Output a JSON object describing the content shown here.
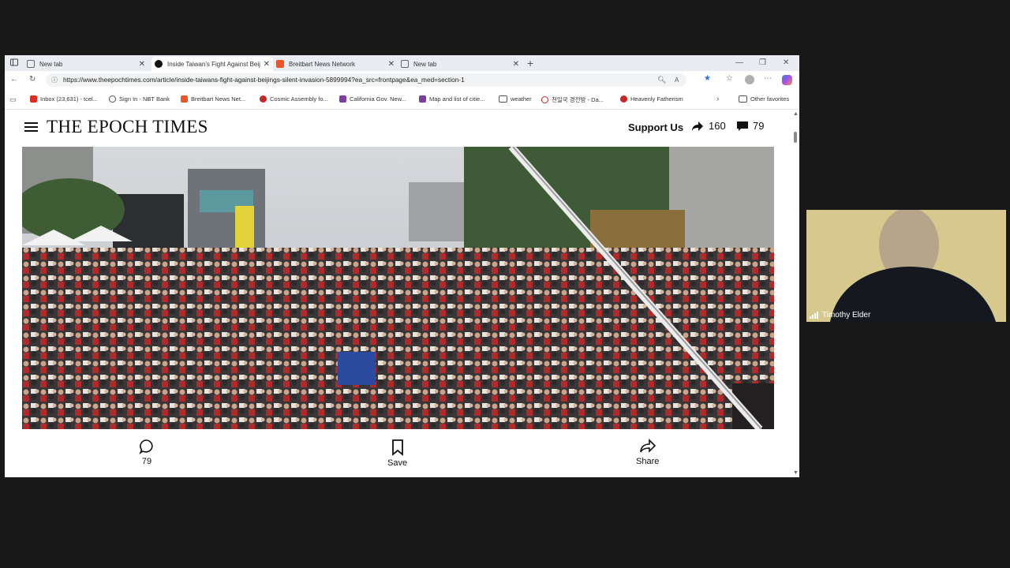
{
  "browser": {
    "tabs": [
      {
        "label": "New tab",
        "favicon": "page-icon",
        "active": false
      },
      {
        "label": "Inside Taiwan's Fight Against Beij",
        "favicon": "epoch-times-icon",
        "active": true
      },
      {
        "label": "Breitbart News Network",
        "favicon": "breitbart-icon",
        "active": false
      },
      {
        "label": "New tab",
        "favicon": "page-icon",
        "active": false
      }
    ],
    "url": "https://www.theepochtimes.com/article/inside-taiwans-fight-against-beijings-silent-invasion-5899994?ea_src=frontpage&ea_med=section-1",
    "bookmarks": [
      {
        "label": "Inbox (23,631) - tcel...",
        "icon": "gmail-icon",
        "color": "#d93025"
      },
      {
        "label": "Sign In - NBT Bank",
        "icon": "globe-icon",
        "color": "#555555"
      },
      {
        "label": "Breitbart News Net...",
        "icon": "breitbart-icon",
        "color": "#e8562a"
      },
      {
        "label": "Cosmic Assembly fo...",
        "icon": "cosmic-icon",
        "color": "#c62828"
      },
      {
        "label": "California Gov. New...",
        "icon": "news-icon",
        "color": "#7b3fa0"
      },
      {
        "label": "Map and list of citie...",
        "icon": "map-icon",
        "color": "#7b3fa0"
      },
      {
        "label": "weather",
        "icon": "folder-icon",
        "color": "#555555"
      },
      {
        "label": "천일국 경전방 - Da...",
        "icon": "site-icon",
        "color": "#c62828"
      },
      {
        "label": "Heavenly Fatherism",
        "icon": "heart-icon",
        "color": "#c62828"
      }
    ],
    "other_favorites": "Other favorites"
  },
  "site": {
    "logo": "THE EPOCH TIMES",
    "support": "Support Us",
    "shares": "160",
    "comments": "79"
  },
  "actions": {
    "comments_count": "79",
    "save_label": "Save",
    "share_label": "Share"
  },
  "video": {
    "participant_name": "Timothy Elder"
  },
  "colors": {
    "accent_blue": "#1a73e8",
    "tabbar": "#e9edf2",
    "background": "#181818"
  }
}
